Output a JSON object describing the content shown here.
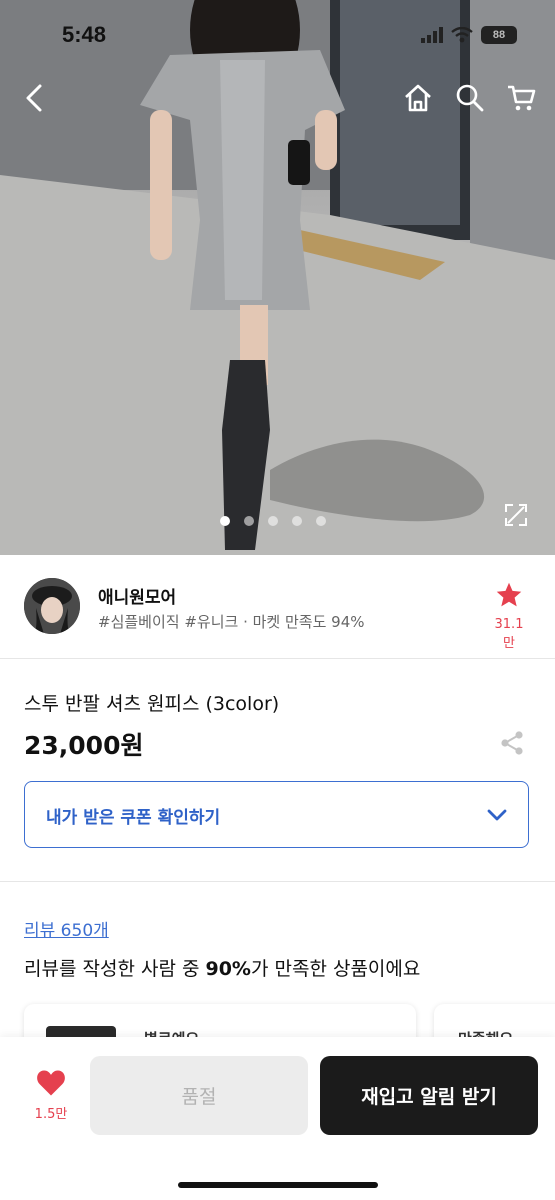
{
  "status_bar": {
    "time": "5:48",
    "battery": "88"
  },
  "nav": {
    "back_icon": "chevron-left-icon",
    "home_icon": "home-icon",
    "search_icon": "search-icon",
    "cart_icon": "cart-icon"
  },
  "carousel": {
    "count": 5,
    "active_index": 0
  },
  "seller": {
    "name": "애니원모어",
    "tags": "#심플베이직 #유니크 · 마켓 만족도 94%",
    "favorite_count": "31.1만",
    "star_color": "#e5404e"
  },
  "product": {
    "name": "스투 반팔 셔츠 원피스 (3color)",
    "price": "23,000원",
    "coupon_label": "내가 받은 쿠폰 확인하기",
    "accent_color": "#3d6fd1"
  },
  "review": {
    "link_text": "리뷰 650개",
    "summary_prefix": "리뷰를 작성한 사람 중 ",
    "summary_percent": "90%",
    "summary_suffix": "가 만족한 상품이에요",
    "cards": [
      {
        "title": "별로예요"
      },
      {
        "title": "만족해요"
      }
    ]
  },
  "bottom_bar": {
    "like_count": "1.5만",
    "soldout_label": "품절",
    "restock_label": "재입고 알림 받기"
  }
}
